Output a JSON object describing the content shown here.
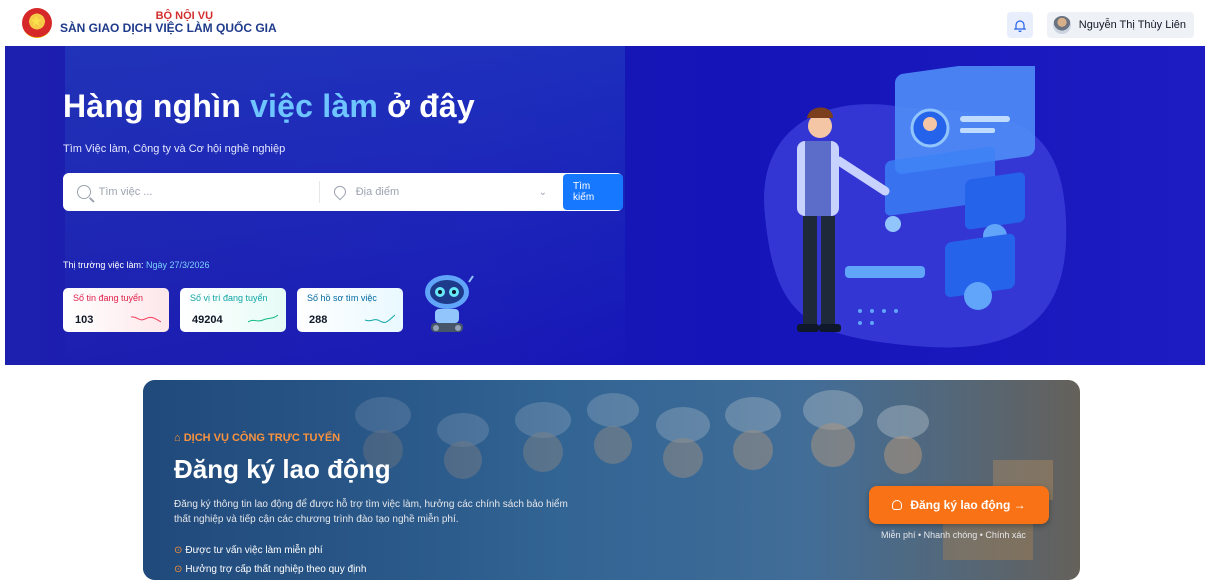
{
  "header": {
    "ministry": "BỘ NỘI VỤ",
    "site_name": "SÀN GIAO DỊCH VIỆC LÀM QUỐC GIA",
    "user_name": "Nguyễn Thị Thùy Liên"
  },
  "hero": {
    "title_part1": "Hàng nghìn ",
    "title_highlight": "việc làm",
    "title_part2": " ở đây",
    "subtitle": "Tìm Việc làm, Công ty và Cơ hội nghề nghiệp",
    "search_placeholder": "Tìm việc ...",
    "location_placeholder": "Địa điểm",
    "search_button": "Tìm kiếm",
    "market_label": "Thị trường việc làm: ",
    "market_date": "Ngày 27/3/2026",
    "stats": [
      {
        "label": "Số tin đang tuyển",
        "value": "103"
      },
      {
        "label": "Số vị trí đang tuyển",
        "value": "49204"
      },
      {
        "label": "Số hồ sơ tìm việc",
        "value": "288"
      }
    ]
  },
  "banner": {
    "service_label": "DỊCH VỤ CÔNG TRỰC TUYẾN",
    "title": "Đăng ký lao động",
    "description": "Đăng ký thông tin lao động để được hỗ trợ tìm việc làm, hưởng các chính sách bảo hiểm thất nghiệp và tiếp cận các chương trình đào tạo nghề miễn phí.",
    "benefits": [
      "Được tư vấn việc làm miễn phí",
      "Hưởng trợ cấp thất nghiệp theo quy định"
    ],
    "button": "Đăng ký lao động →",
    "note": "Miễn phí • Nhanh chóng • Chính xác"
  },
  "icons": {
    "bell": "bell-icon",
    "search": "search-icon",
    "location": "location-pin-icon",
    "chevron": "chevron-down-icon",
    "building": "bank-icon",
    "check": "check-circle-icon",
    "user": "user-icon"
  },
  "colors": {
    "hero_bg": "#1a1ab6",
    "highlight": "#6ec5ff",
    "accent_orange": "#f97316",
    "search_button": "#1677ff"
  }
}
